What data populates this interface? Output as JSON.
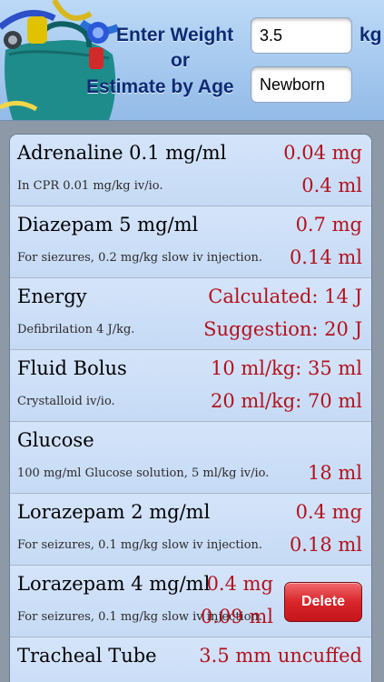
{
  "header": {
    "weight_label": "Enter Weight",
    "weight_value": "3.5",
    "weight_unit": "kg",
    "or_label": "or",
    "age_label": "Estimate by Age",
    "age_value": "Newborn"
  },
  "drugs": [
    {
      "name": "Adrenaline  0.1 mg/ml",
      "desc": "In CPR 0.01 mg/kg iv/io.",
      "v1": "0.04 mg",
      "v2": "0.4 ml"
    },
    {
      "name": "Diazepam  5 mg/ml",
      "desc": "For siezures, 0.2 mg/kg slow iv injection.",
      "v1": "0.7 mg",
      "v2": "0.14 ml"
    },
    {
      "name": "Energy",
      "desc": "Defibrilation 4 J/kg.",
      "v1": "Calculated: 14 J",
      "v2": "Suggestion: 20 J"
    },
    {
      "name": "Fluid Bolus",
      "desc": "Crystalloid iv/io.",
      "v1": "10 ml/kg: 35 ml",
      "v2": "20 ml/kg: 70 ml"
    },
    {
      "name": "Glucose",
      "desc": "100 mg/ml Glucose solution, 5 ml/kg iv/io.",
      "v1": "",
      "v2": "18 ml"
    },
    {
      "name": "Lorazepam  2 mg/ml",
      "desc": "For seizures, 0.1 mg/kg slow iv injection.",
      "v1": "0.4 mg",
      "v2": "0.18 ml"
    },
    {
      "name": "Lorazepam  4 mg/ml",
      "desc": "For seizures, 0.1 mg/kg slow iv injection.",
      "v1": "0.4 mg",
      "v2": "0.09 ml"
    },
    {
      "name": "Tracheal Tube",
      "desc": "",
      "v1": "3.5 mm uncuffed",
      "v2": ""
    }
  ],
  "delete_label": "Delete",
  "colors": {
    "value_red": "#b3111c",
    "header_text": "#0d2a73",
    "row_bg": "#ccdff7"
  },
  "icons": {
    "header_art": "medical-bag-icon"
  }
}
